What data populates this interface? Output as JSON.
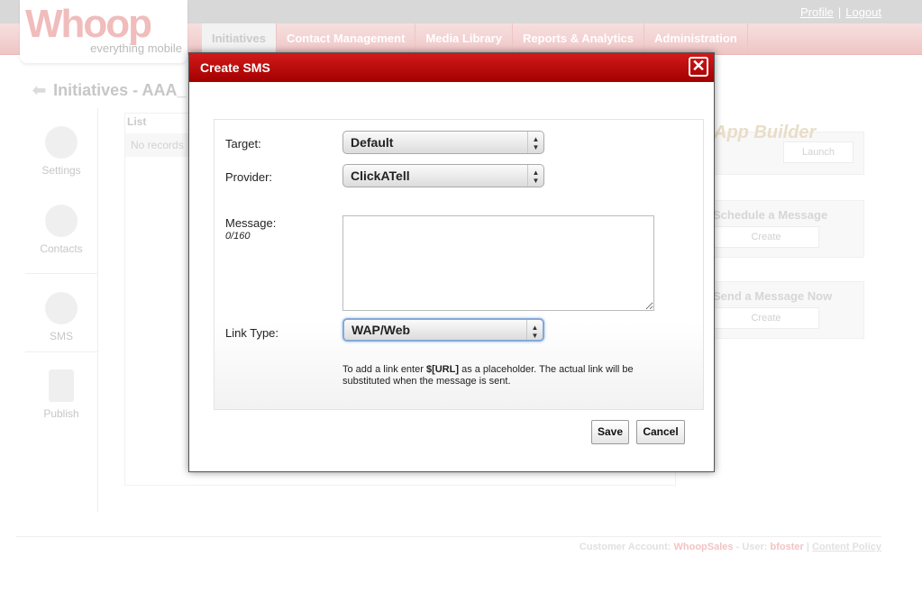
{
  "header": {
    "logo_text": "Whoop",
    "logo_tagline": "everything mobile",
    "profile_link": "Profile",
    "separator": "|",
    "logout_link": "Logout",
    "nav_tabs": [
      {
        "label": "Initiatives",
        "active": true
      },
      {
        "label": "Contact Management"
      },
      {
        "label": "Media Library"
      },
      {
        "label": "Reports & Analytics"
      },
      {
        "label": "Administration"
      }
    ]
  },
  "page": {
    "title": "Initiatives - AAA_",
    "sidebar": [
      {
        "label": "Settings",
        "icon": "tools-icon"
      },
      {
        "label": "Contacts",
        "icon": "contacts-icon"
      },
      {
        "label": "SMS",
        "icon": "satellite-dish-icon"
      },
      {
        "label": "Publish",
        "icon": "publish-icon"
      }
    ],
    "list_heading": "List",
    "list_empty": "No records",
    "app_builder_label": "App Builder",
    "launch_button": "Launch",
    "schedule_title": "Schedule a Message",
    "schedule_button": "Create",
    "send_title": "Send a Message Now",
    "send_button": "Create"
  },
  "footer": {
    "account_label": "Customer Account:",
    "account_name": "WhoopSales",
    "dash": "-",
    "user_label": "User:",
    "user_name": "bfoster",
    "separator": "|",
    "policy_link": "Content Policy"
  },
  "modal": {
    "title": "Create SMS",
    "close_symbol": "✕",
    "target_label": "Target:",
    "target_value": "Default",
    "provider_label": "Provider:",
    "provider_value": "ClickATell",
    "message_label": "Message:",
    "message_counter": "0/160",
    "message_value": "",
    "link_type_label": "Link Type:",
    "link_type_value": "WAP/Web",
    "hint_prefix": "To add a link enter ",
    "hint_placeholder": "$[URL]",
    "hint_suffix": " as a placeholder. The actual link will be substituted when the message is sent.",
    "save_button": "Save",
    "cancel_button": "Cancel"
  },
  "colors": {
    "modal_header": "#b40000",
    "brand_pink": "#f0b9b9",
    "focus_ring": "#86a8d8"
  }
}
